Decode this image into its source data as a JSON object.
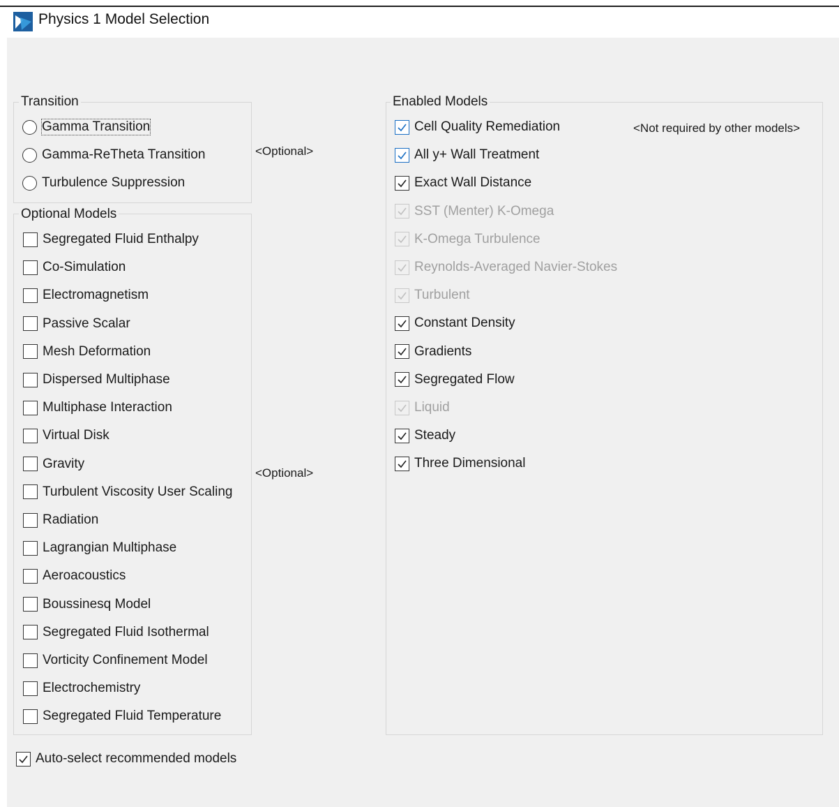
{
  "window": {
    "title": "Physics 1 Model Selection",
    "icon": "star-ccm-app-icon"
  },
  "transition": {
    "label": "Transition",
    "options": [
      {
        "label": "Gamma Transition",
        "selected": false,
        "focused": true
      },
      {
        "label": "Gamma-ReTheta Transition",
        "selected": false
      },
      {
        "label": "Turbulence Suppression",
        "selected": false
      }
    ],
    "note": "<Optional>"
  },
  "optional_models": {
    "label": "Optional Models",
    "items": [
      {
        "label": "Segregated Fluid Enthalpy",
        "checked": false
      },
      {
        "label": "Co-Simulation",
        "checked": false
      },
      {
        "label": "Electromagnetism",
        "checked": false
      },
      {
        "label": "Passive Scalar",
        "checked": false
      },
      {
        "label": "Mesh Deformation",
        "checked": false
      },
      {
        "label": "Dispersed Multiphase",
        "checked": false
      },
      {
        "label": "Multiphase Interaction",
        "checked": false
      },
      {
        "label": "Virtual Disk",
        "checked": false
      },
      {
        "label": "Gravity",
        "checked": false
      },
      {
        "label": "Turbulent Viscosity User Scaling",
        "checked": false
      },
      {
        "label": "Radiation",
        "checked": false
      },
      {
        "label": "Lagrangian Multiphase",
        "checked": false
      },
      {
        "label": "Aeroacoustics",
        "checked": false
      },
      {
        "label": "Boussinesq Model",
        "checked": false
      },
      {
        "label": "Segregated Fluid Isothermal",
        "checked": false
      },
      {
        "label": "Vorticity Confinement Model",
        "checked": false
      },
      {
        "label": "Electrochemistry",
        "checked": false
      },
      {
        "label": "Segregated Fluid Temperature",
        "checked": false
      }
    ],
    "note": "<Optional>"
  },
  "enabled_models": {
    "label": "Enabled Models",
    "note": "<Not required by other models>",
    "items": [
      {
        "label": "Cell Quality Remediation",
        "checked": true,
        "enabled": true,
        "accent": true
      },
      {
        "label": "All y+ Wall Treatment",
        "checked": true,
        "enabled": true,
        "accent": true
      },
      {
        "label": "Exact Wall Distance",
        "checked": true,
        "enabled": true
      },
      {
        "label": "SST (Menter) K-Omega",
        "checked": true,
        "enabled": false
      },
      {
        "label": "K-Omega Turbulence",
        "checked": true,
        "enabled": false
      },
      {
        "label": "Reynolds-Averaged Navier-Stokes",
        "checked": true,
        "enabled": false
      },
      {
        "label": "Turbulent",
        "checked": true,
        "enabled": false
      },
      {
        "label": "Constant Density",
        "checked": true,
        "enabled": true
      },
      {
        "label": "Gradients",
        "checked": true,
        "enabled": true
      },
      {
        "label": "Segregated Flow",
        "checked": true,
        "enabled": true
      },
      {
        "label": "Liquid",
        "checked": true,
        "enabled": false
      },
      {
        "label": "Steady",
        "checked": true,
        "enabled": true
      },
      {
        "label": "Three Dimensional",
        "checked": true,
        "enabled": true
      }
    ]
  },
  "auto_select": {
    "label": "Auto-select recommended models",
    "checked": true
  },
  "colors": {
    "accent": "#1a6fc4",
    "disabled": "#a0a0a0",
    "panel": "#f0f0f0"
  }
}
